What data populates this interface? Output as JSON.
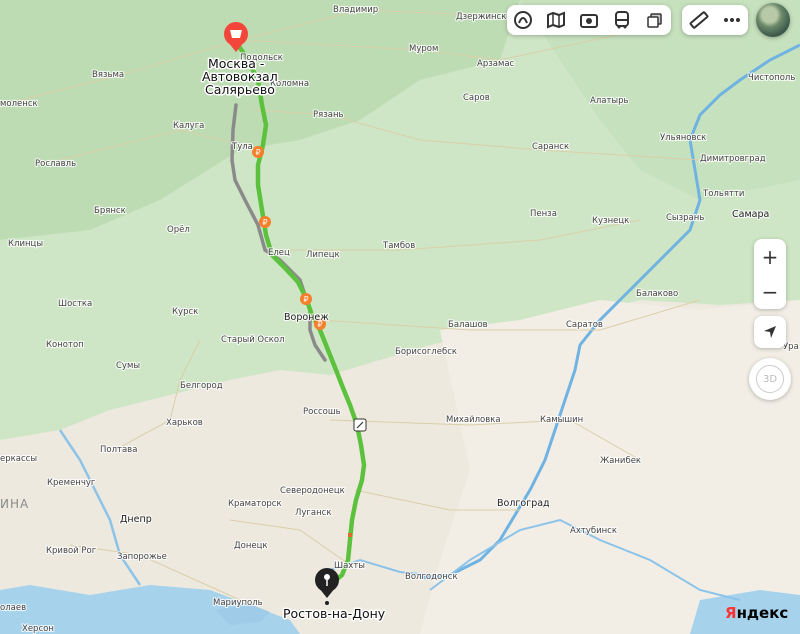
{
  "route": {
    "origin_label_line1": "Москва -",
    "origin_label_line2": "Автовокзал",
    "origin_label_line3": "Салярьево",
    "destination_label": "Ростов-на-Дону",
    "route_color": "#5cc23d",
    "alt_route_color": "#8a8a8a",
    "origin_marker_color": "#f2463a",
    "destination_marker_color": "#222222"
  },
  "cities": {
    "vladimir": "Владимир",
    "dzerzhinsk": "Дзержинск",
    "murom": "Муром",
    "arzamas": "Арзамас",
    "vyazma": "Вязьма",
    "smolensk": "моленск",
    "kolomna": "Коломна",
    "podolsk": "Подольск",
    "ryazan": "Рязань",
    "sarov": "Саров",
    "alatyr": "Алатырь",
    "chistopol": "Чистополь",
    "kaluga": "Калуга",
    "tula": "Тула",
    "roslavl": "Рославль",
    "saransk": "Саранск",
    "ulyanovsk": "Ульяновск",
    "dimitrovgrad": "Димитровград",
    "bryansk": "Брянск",
    "penza": "Пенза",
    "kuznetsk": "Кузнецк",
    "tolyatti": "Тольятти",
    "samara": "Самара",
    "syzran": "Сызрань",
    "klintsy": "Клинцы",
    "oryol": "Орёл",
    "yelets": "Елец",
    "lipetsk": "Липецк",
    "tambov": "Тамбов",
    "balakovo": "Балаково",
    "shostka": "Шостка",
    "kursk": "Курск",
    "voronezh": "Воронеж",
    "balashov": "Балашов",
    "saratov": "Саратов",
    "konotop": "Конотоп",
    "stary_oskol": "Старый Оскол",
    "borisoglebsk": "Борисоглебск",
    "sumy": "Сумы",
    "belgorod": "Белгород",
    "rossosh": "Россошь",
    "mikhaylovka": "Михайловка",
    "kamyshin": "Камышин",
    "kharkov": "Харьков",
    "cherkassy": "еркассы",
    "poltava": "Полтава",
    "zhanibek": "Жанибек",
    "kremenchug": "Кременчуг",
    "severodonetsk": "Северодонецк",
    "kramatorsk": "Краматорск",
    "volgograd": "Волгоград",
    "dnepr": "Днепр",
    "lugansk": "Луганск",
    "akhtubinsk": "Ахтубинск",
    "krivoy_rog": "Кривой Рог",
    "zaporozhye": "Запорожье",
    "donetsk": "Донецк",
    "shakhty": "Шахты",
    "volgodonsk": "Волгодонск",
    "mariupol": "Мариуполь",
    "nikolaev": "олаев",
    "kherson": "Херсон",
    "country_ukraine": "ИНА",
    "ura": "Ура"
  },
  "controls": {
    "zoom_in": "+",
    "zoom_out": "−",
    "compass": "3D"
  },
  "logo": {
    "first_letter": "Я",
    "rest": "ндекс"
  }
}
